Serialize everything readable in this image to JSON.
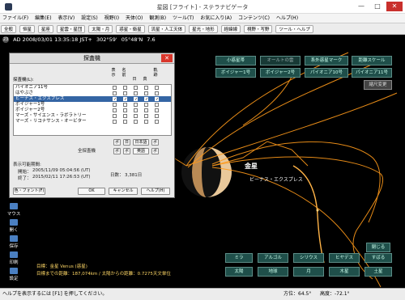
{
  "window": {
    "title": "星図 [フライト] - ステラナビゲータ",
    "controls": [
      "—",
      "□",
      "✕"
    ]
  },
  "menu": [
    "ファイル(F)",
    "編集(E)",
    "表示(V)",
    "設定(S)",
    "視野(I)",
    "天体(O)",
    "観測(B)",
    "ツール(T)",
    "お気に入り(A)",
    "コンテンツ(C)",
    "ヘルプ(H)"
  ],
  "toolbar": [
    "全般",
    "恒星",
    "星座",
    "星雲・星団",
    "太陽・月",
    "惑星・衛星",
    "流星・人工天体",
    "星光・地形",
    "経緯線",
    "視野・写野",
    "ツール・ヘルプ"
  ],
  "status": {
    "badge": "23",
    "text": "AD 2008/03/01 13:35:18 JST+",
    "az": "302°59'",
    "alt": "05°48'N",
    "mag": "7.6"
  },
  "sky": {
    "buttons_top": [
      "小惑星帯",
      "オールトの雲",
      "系外惑星マーク",
      "距離スケール",
      "ボイジャー1号",
      "ボイジャー2号",
      "パイオニア10号",
      "パイオニア11号",
      "縮尺変更"
    ],
    "buttons_bottom": [
      "ミラ",
      "アルゴル",
      "シリウス",
      "ヒヤデス",
      "すばる",
      "太陽",
      "地球",
      "月",
      "木星",
      "土星"
    ],
    "fold_label": "閉じる",
    "planet_label": "金星",
    "probe_label": "ビーナス・エクスプレス",
    "target_line1": "目標：金星 Venus (惑星)",
    "target_line2": "目標までの距離：187,074km / 太陽からの距離：0.7275天文単位"
  },
  "side": [
    "マウス",
    "開く",
    "保存",
    "印刷",
    "設定"
  ],
  "bottom": {
    "hint": "ヘルプを表示するには [F1] を押してください。",
    "dir": "方位：64.5°",
    "alt": "高度：-72.1°"
  },
  "dialog": {
    "title": "探査機",
    "close": "✕",
    "list_label": "探査機(L):",
    "col_heads": [
      "表示",
      "名前",
      "日",
      "真",
      "軌跡"
    ],
    "rows": [
      {
        "name": "パイオニア11号",
        "checks": [
          0,
          0,
          0,
          0,
          0
        ]
      },
      {
        "name": "はやぶさ",
        "checks": [
          0,
          0,
          0,
          0,
          0
        ]
      },
      {
        "name": "ビーナス・エクスプレス",
        "checks": [
          1,
          1,
          1,
          1,
          1
        ],
        "selected": true
      },
      {
        "name": "ボイジャー1号",
        "checks": [
          0,
          0,
          0,
          0,
          0
        ]
      },
      {
        "name": "ボイジャー2号",
        "checks": [
          0,
          0,
          0,
          0,
          0
        ]
      },
      {
        "name": "マーズ・サイエンス・ラボラトリー",
        "checks": [
          0,
          0,
          0,
          0,
          0
        ]
      },
      {
        "name": "マーズ・リコナサンス・オービター",
        "checks": [
          0,
          0,
          0,
          0,
          0
        ]
      }
    ],
    "all_label": "全探査機",
    "btns_row1": [
      "ボ",
      "日",
      "日本語",
      "ボ"
    ],
    "btns_row2": [
      "ボ",
      "ボ",
      "英語",
      "ボ"
    ],
    "period_label": "表示可能期間:",
    "start_label": "開始：",
    "start_value": "2005/11/09 05:04:56 (UT)",
    "end_label": "終了：",
    "end_value": "2015/02/11 17:26:53 (UT)",
    "days_label": "日数：",
    "days_value": "3,381日",
    "font_btn": "色・フォント(F)",
    "ok": "OK",
    "cancel": "キャンセル",
    "help": "ヘルプ(H)"
  },
  "colors": {
    "orbit": "#ff9a1a",
    "sky_btn_bg": "#1f4f4a",
    "sky_bg": "#000000",
    "accent_sel": "#3465a4",
    "close_red": "#d9362b",
    "target_text": "#ffd866"
  }
}
